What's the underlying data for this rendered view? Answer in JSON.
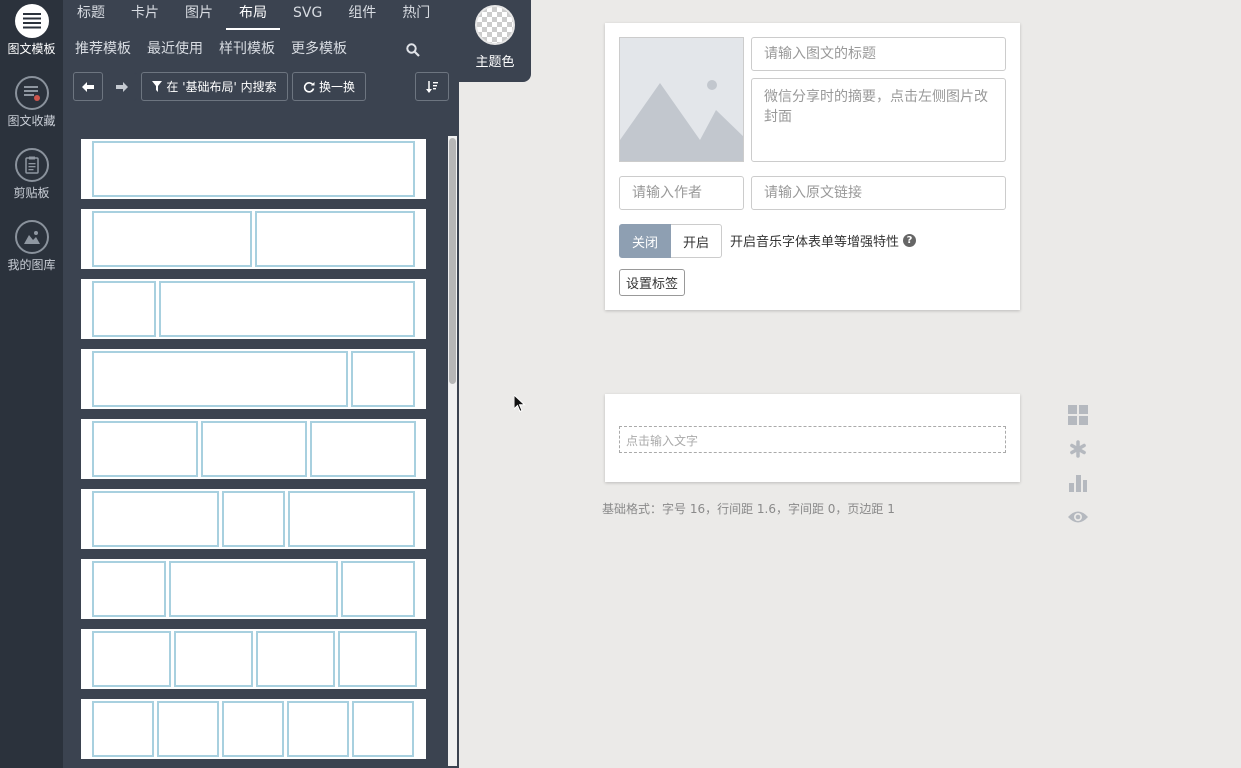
{
  "rail": {
    "items": [
      {
        "label": "图文模板",
        "icon": "list-icon"
      },
      {
        "label": "图文收藏",
        "icon": "favorites-icon"
      },
      {
        "label": "剪贴板",
        "icon": "clipboard-icon"
      },
      {
        "label": "我的图库",
        "icon": "gallery-icon"
      }
    ]
  },
  "panel": {
    "tabs": [
      "标题",
      "卡片",
      "图片",
      "布局",
      "SVG",
      "组件",
      "热门"
    ],
    "active_tab": "布局",
    "subtabs": [
      "推荐模板",
      "最近使用",
      "样刊模板",
      "更多模板"
    ],
    "search_label": "在 '基础布局' 内搜索",
    "shuffle_label": "换一换",
    "layout_rows": [
      [
        1
      ],
      [
        1,
        1
      ],
      [
        1,
        4
      ],
      [
        4,
        1
      ],
      [
        1,
        1,
        1
      ],
      [
        1.2,
        0.6,
        1.2
      ],
      [
        0.7,
        1.6,
        0.7
      ],
      [
        1,
        1,
        1,
        1
      ],
      [
        1,
        1,
        1,
        1,
        1
      ]
    ]
  },
  "theme": {
    "label": "主题色"
  },
  "editor": {
    "title_placeholder": "请输入图文的标题",
    "summary_placeholder": "微信分享时的摘要，点击左侧图片改封面",
    "author_placeholder": "请输入作者",
    "link_placeholder": "请输入原文链接",
    "toggle_off": "关闭",
    "toggle_on": "开启",
    "enhance_label": "开启音乐字体表单等增强特性",
    "help_glyph": "?",
    "tag_button": "设置标签"
  },
  "text_card": {
    "placeholder": "点击输入文字"
  },
  "status": {
    "text": "基础格式：字号 16，行间距 1.6，字间距 0，页边距 1"
  },
  "colors": {
    "rail_bg": "#2b323c",
    "panel_bg": "#3b4350",
    "layout_border": "#a8d0df",
    "toggle_active": "#8e9fb2"
  }
}
